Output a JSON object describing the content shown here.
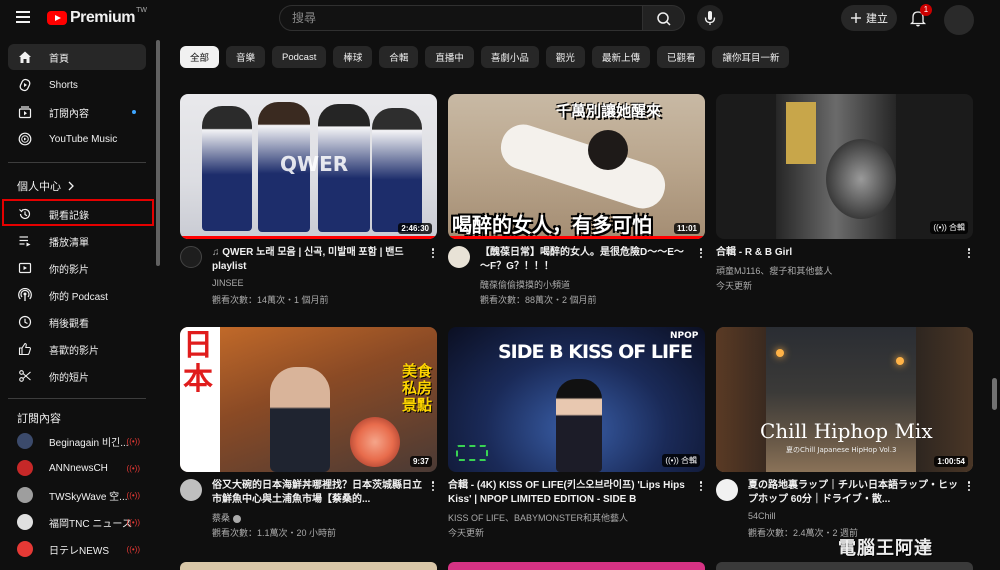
{
  "header": {
    "logo": "Premium",
    "logo_region": "TW",
    "search_placeholder": "搜尋",
    "create_label": "建立",
    "notifications_count": "1"
  },
  "sidebar": {
    "main": [
      {
        "label": "首頁",
        "icon": "home-icon"
      },
      {
        "label": "Shorts",
        "icon": "shorts-icon"
      },
      {
        "label": "訂閱內容",
        "icon": "subscriptions-icon"
      },
      {
        "label": "YouTube Music",
        "icon": "youtube-music-icon"
      }
    ],
    "you_heading": "個人中心",
    "you": [
      {
        "label": "觀看記錄",
        "icon": "history-icon"
      },
      {
        "label": "播放清單",
        "icon": "playlists-icon"
      },
      {
        "label": "你的影片",
        "icon": "your-videos-icon"
      },
      {
        "label": "你的 Podcast",
        "icon": "podcast-icon"
      },
      {
        "label": "稍後觀看",
        "icon": "watch-later-icon"
      },
      {
        "label": "喜歡的影片",
        "icon": "liked-videos-icon"
      },
      {
        "label": "你的短片",
        "icon": "your-clips-icon"
      }
    ],
    "subs_heading": "訂閱內容",
    "subs": [
      {
        "label": "Beginagain 비긴...",
        "color": "#3b4a6b"
      },
      {
        "label": "ANNnewsCH",
        "color": "#c62828"
      },
      {
        "label": "TWSkyWave 空...",
        "color": "#9e9e9e"
      },
      {
        "label": "福岡TNC ニュース",
        "color": "#e0e0e0"
      },
      {
        "label": "日テレNEWS",
        "color": "#e53935"
      }
    ]
  },
  "chips": [
    "全部",
    "音樂",
    "Podcast",
    "棒球",
    "合輯",
    "直播中",
    "喜劇小品",
    "觀光",
    "最新上傳",
    "已觀看",
    "讓你耳目一新"
  ],
  "videos": [
    {
      "title": "QWER 노래 모음 | 신곡, 미발매 포함 | 밴드 playlist",
      "channel": "JINSEE",
      "meta": "觀看次數：14萬次・1 個月前",
      "duration": "2:46:30",
      "overlay": "QWER"
    },
    {
      "title": "【醜葆日常】喝醉的女人。是很危險D～～E～～F？G？！！！",
      "channel": "醜葆偷偷摸摸的小頻道",
      "meta": "觀看次數：88萬次・2 個月前",
      "duration": "11:01",
      "overlay": "千萬別讓她醒來",
      "overlay2": "喝醉的女人，有多可怕"
    },
    {
      "title": "合輯 - R & B Girl",
      "channel": "頑童MJ116、瘦子和其他藝人",
      "meta": "今天更新",
      "duration": "合輯"
    },
    {
      "title": "俗又大碗的日本海鮮丼哪裡找？日本茨城縣日立市鮮魚中心與土浦魚市場【蔡桑的...",
      "channel": "蔡桑",
      "meta": "觀看次數：1.1萬次・20 小時前",
      "duration": "9:37",
      "overlay": "日本",
      "overlay2": "美食私房景點"
    },
    {
      "title": "合輯 - (4K) KISS OF LIFE(키스오브라이프) 'Lips Hips Kiss' | NPOP LIMITED EDITION - SIDE B",
      "channel": "KISS OF LIFE、BABYMONSTER和其他藝人",
      "meta": "今天更新",
      "duration": "合輯",
      "overlay": "SIDE B KISS OF LIFE",
      "overlay2": "NPOP"
    },
    {
      "title": "夏の路地裏ラップ｜チルい日本語ラップ・ヒップホップ 60分｜ドライブ・散...",
      "channel": "54Chill",
      "meta": "觀看次數：2.4萬次・2 週前",
      "duration": "1:00:54",
      "overlay": "Chill Hiphop Mix",
      "overlay2": "夏のChill Japanese HipHop Vol.3"
    }
  ],
  "watermark": "電腦王阿達"
}
